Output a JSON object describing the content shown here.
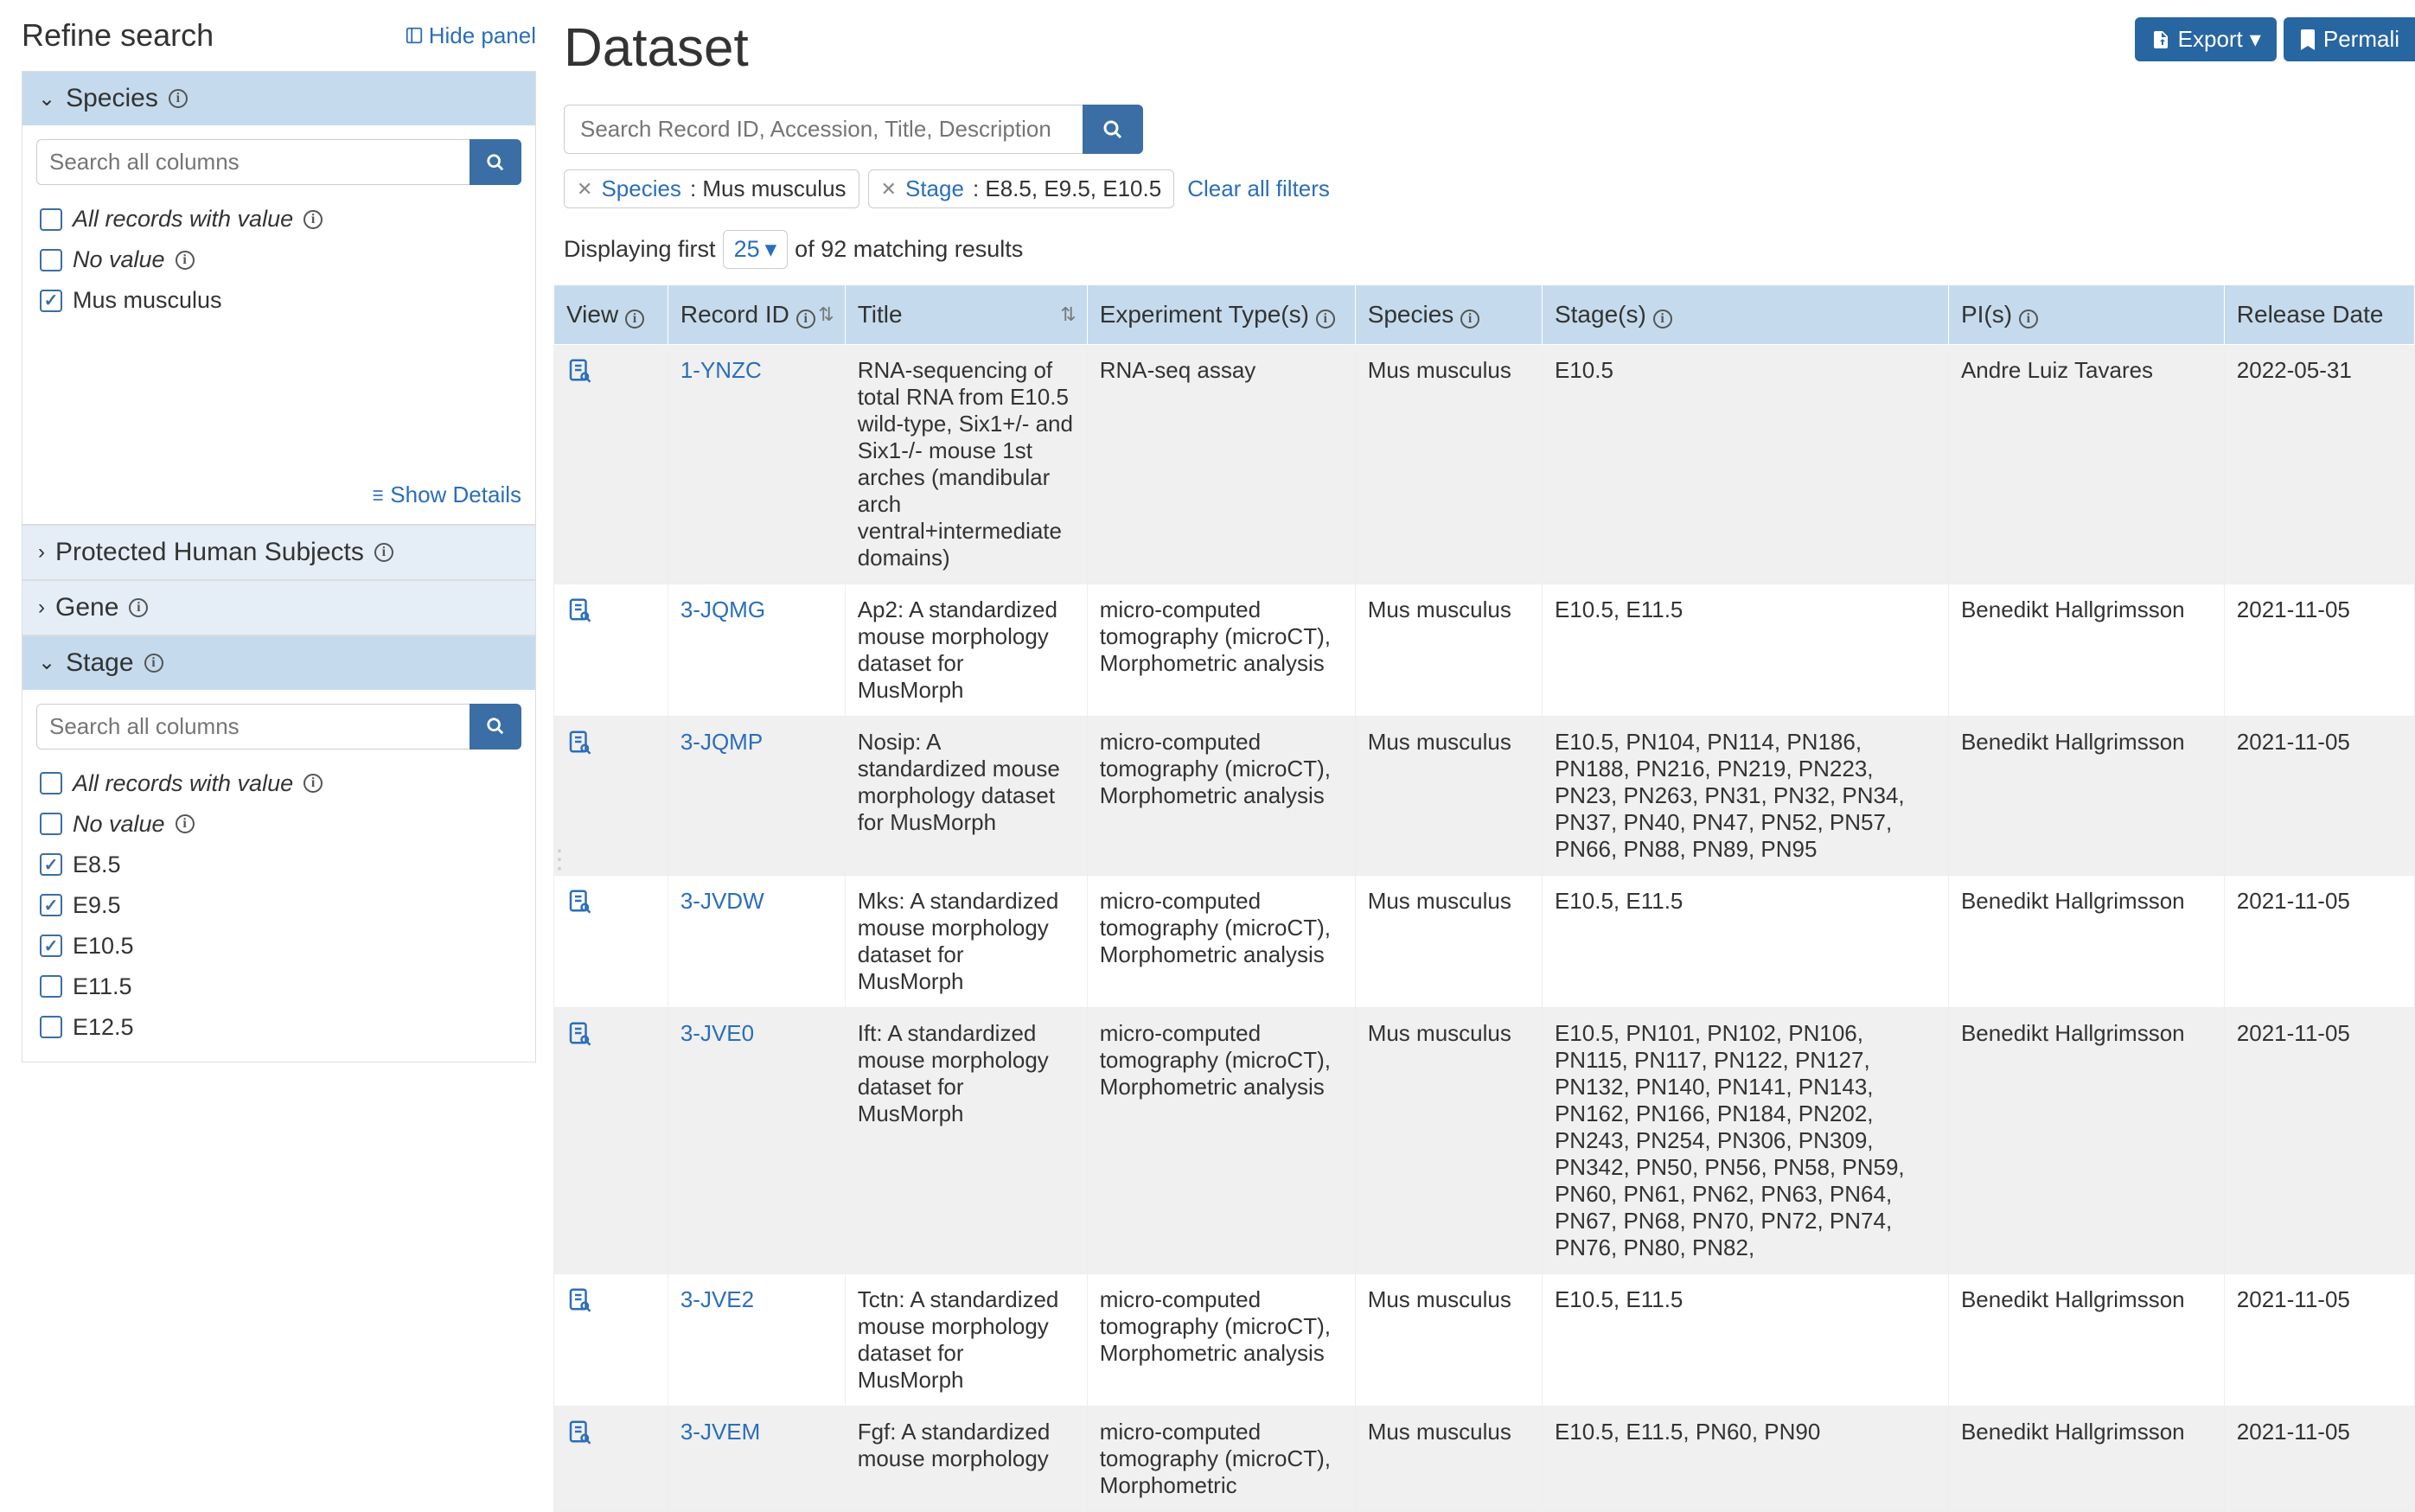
{
  "page": {
    "title": "Dataset",
    "export_label": "Export",
    "permalink_label": "Permali"
  },
  "search": {
    "placeholder": "Search Record ID, Accession, Title, Description"
  },
  "filters": {
    "chips": [
      {
        "key": "Species",
        "val": ": Mus musculus"
      },
      {
        "key": "Stage",
        "val": ": E8.5, E9.5, E10.5"
      }
    ],
    "clear_label": "Clear all filters"
  },
  "results": {
    "prefix": "Displaying first",
    "page_size": "25",
    "suffix": "of 92 matching results"
  },
  "sidebar": {
    "refine_title": "Refine search",
    "hide_panel": "Hide panel",
    "search_all_placeholder": "Search all columns",
    "show_details": "Show Details",
    "facets": {
      "species": {
        "title": "Species",
        "options": [
          {
            "label": "All records with value",
            "italic": true,
            "checked": false,
            "info": true
          },
          {
            "label": "No value",
            "italic": true,
            "checked": false,
            "info": true
          },
          {
            "label": "Mus musculus",
            "italic": false,
            "checked": true,
            "info": false
          }
        ]
      },
      "protected": {
        "title": "Protected Human Subjects"
      },
      "gene": {
        "title": "Gene"
      },
      "stage": {
        "title": "Stage",
        "options": [
          {
            "label": "All records with value",
            "italic": true,
            "checked": false,
            "info": true
          },
          {
            "label": "No value",
            "italic": true,
            "checked": false,
            "info": true
          },
          {
            "label": "E8.5",
            "italic": false,
            "checked": true,
            "info": false
          },
          {
            "label": "E9.5",
            "italic": false,
            "checked": true,
            "info": false
          },
          {
            "label": "E10.5",
            "italic": false,
            "checked": true,
            "info": false
          },
          {
            "label": "E11.5",
            "italic": false,
            "checked": false,
            "info": false
          },
          {
            "label": "E12.5",
            "italic": false,
            "checked": false,
            "info": false
          }
        ]
      }
    }
  },
  "table": {
    "headers": {
      "view": "View",
      "record_id": "Record ID",
      "title": "Title",
      "exp_types": "Experiment Type(s)",
      "species": "Species",
      "stages": "Stage(s)",
      "pis": "PI(s)",
      "release_date": "Release Date"
    },
    "rows": [
      {
        "record_id": "1-YNZC",
        "title": "RNA-sequencing of total RNA from E10.5 wild-type, Six1+/- and Six1-/- mouse 1st arches (mandibular arch ventral+intermediate domains)",
        "exp_types": "RNA-seq assay",
        "species": "Mus musculus",
        "stages": "E10.5",
        "pis": "Andre Luiz Tavares",
        "release_date": "2022-05-31"
      },
      {
        "record_id": "3-JQMG",
        "title": "Ap2: A standardized mouse morphology dataset for MusMorph",
        "exp_types": "micro-computed tomography (microCT), Morphometric analysis",
        "species": "Mus musculus",
        "stages": "E10.5, E11.5",
        "pis": "Benedikt Hallgrimsson",
        "release_date": "2021-11-05"
      },
      {
        "record_id": "3-JQMP",
        "title": "Nosip: A standardized mouse morphology dataset for MusMorph",
        "exp_types": "micro-computed tomography (microCT), Morphometric analysis",
        "species": "Mus musculus",
        "stages": "E10.5, PN104, PN114, PN186, PN188, PN216, PN219, PN223, PN23, PN263, PN31, PN32, PN34, PN37, PN40, PN47, PN52, PN57, PN66, PN88, PN89, PN95",
        "pis": "Benedikt Hallgrimsson",
        "release_date": "2021-11-05"
      },
      {
        "record_id": "3-JVDW",
        "title": "Mks: A standardized mouse morphology dataset for MusMorph",
        "exp_types": "micro-computed tomography (microCT), Morphometric analysis",
        "species": "Mus musculus",
        "stages": "E10.5, E11.5",
        "pis": "Benedikt Hallgrimsson",
        "release_date": "2021-11-05"
      },
      {
        "record_id": "3-JVE0",
        "title": "Ift: A standardized mouse morphology dataset for MusMorph",
        "exp_types": "micro-computed tomography (microCT), Morphometric analysis",
        "species": "Mus musculus",
        "stages": "E10.5, PN101, PN102, PN106, PN115, PN117, PN122, PN127, PN132, PN140, PN141, PN143, PN162, PN166, PN184, PN202, PN243, PN254, PN306, PN309, PN342, PN50, PN56, PN58, PN59, PN60, PN61, PN62, PN63, PN64, PN67, PN68, PN70, PN72, PN74, PN76, PN80, PN82,",
        "pis": "Benedikt Hallgrimsson",
        "release_date": "2021-11-05"
      },
      {
        "record_id": "3-JVE2",
        "title": "Tctn: A standardized mouse morphology dataset for MusMorph",
        "exp_types": "micro-computed tomography (microCT), Morphometric analysis",
        "species": "Mus musculus",
        "stages": "E10.5, E11.5",
        "pis": "Benedikt Hallgrimsson",
        "release_date": "2021-11-05"
      },
      {
        "record_id": "3-JVEM",
        "title": "Fgf: A standardized mouse morphology",
        "exp_types": "micro-computed tomography (microCT), Morphometric",
        "species": "Mus musculus",
        "stages": "E10.5, E11.5, PN60, PN90",
        "pis": "Benedikt Hallgrimsson",
        "release_date": "2021-11-05"
      }
    ]
  }
}
